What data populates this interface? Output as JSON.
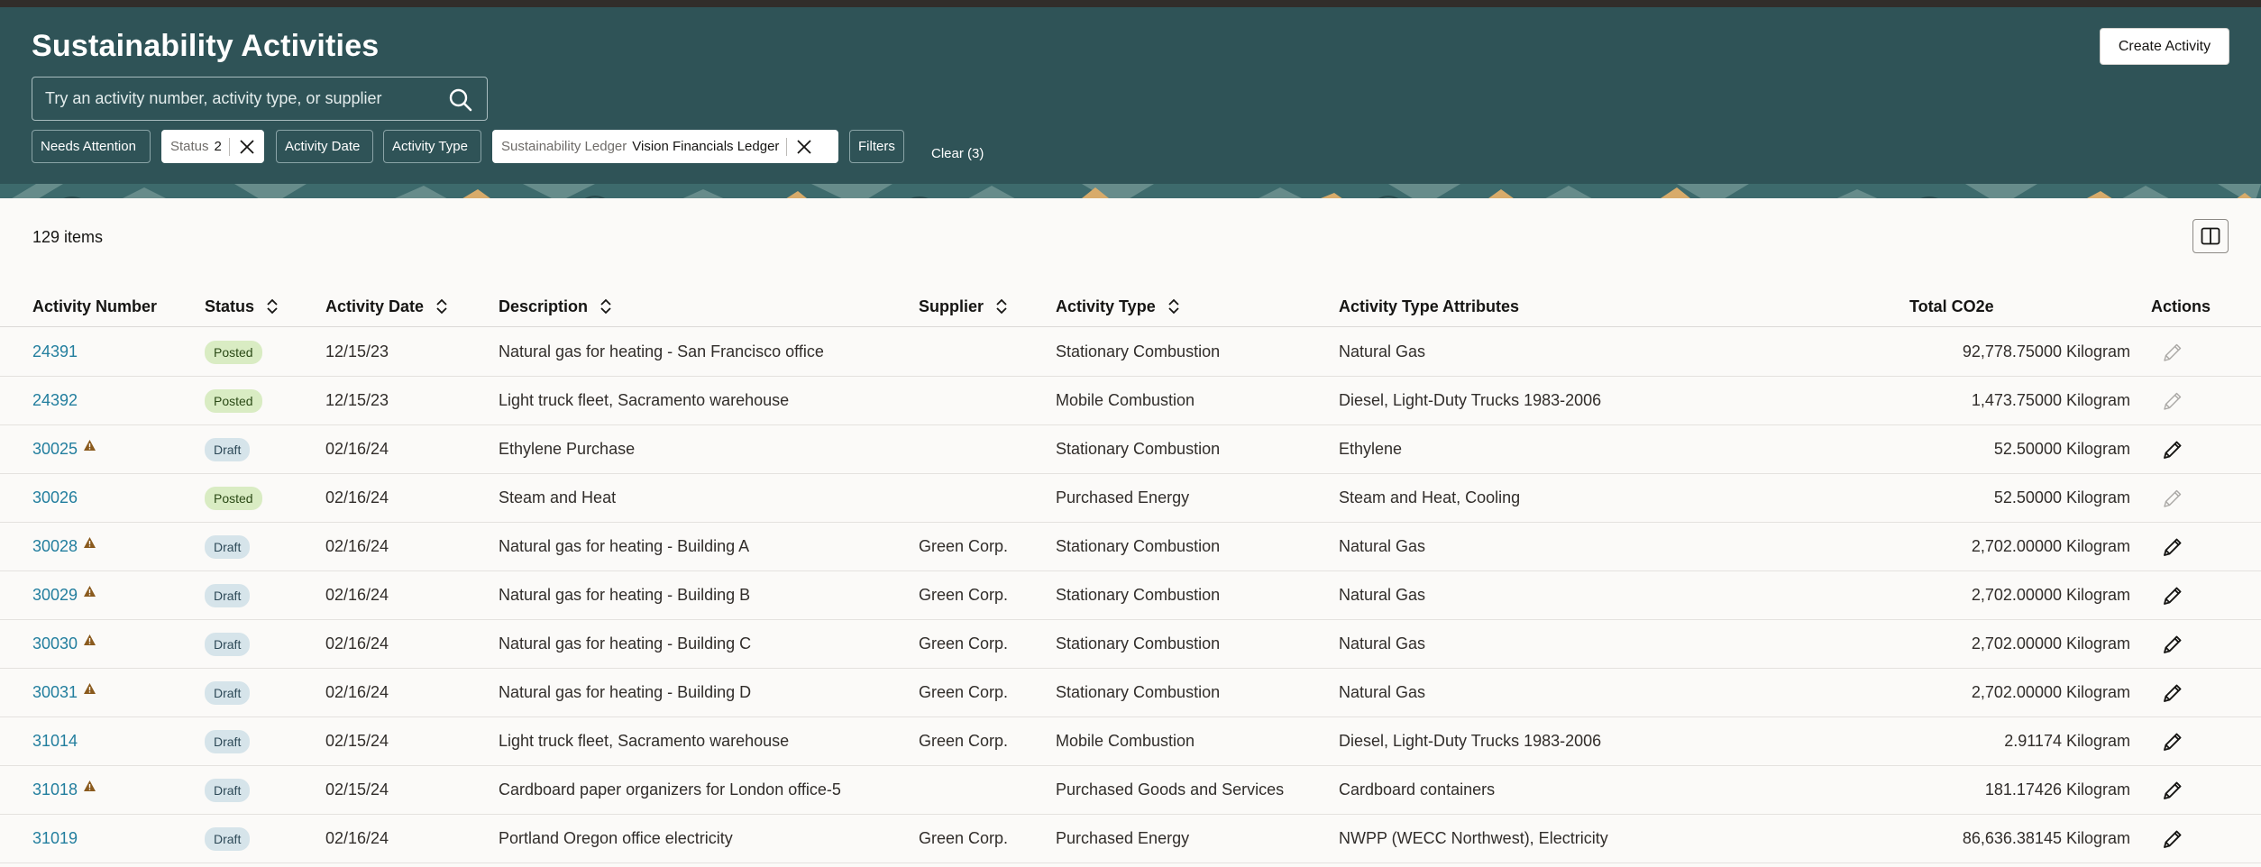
{
  "header": {
    "title": "Sustainability Activities",
    "create_button": "Create Activity",
    "search_placeholder": "Try an activity number, activity type, or supplier",
    "filters": {
      "needs_attention": "Needs Attention",
      "status_label": "Status",
      "status_value": "2",
      "activity_date": "Activity Date",
      "activity_type": "Activity Type",
      "ledger_label": "Sustainability Ledger",
      "ledger_value": "Vision Financials Ledger",
      "filters": "Filters",
      "clear": "Clear (3)"
    }
  },
  "table": {
    "item_count": "129 items",
    "columns": {
      "activity_number": "Activity Number",
      "status": "Status",
      "activity_date": "Activity Date",
      "description": "Description",
      "supplier": "Supplier",
      "activity_type": "Activity Type",
      "attributes": "Activity Type Attributes",
      "total": "Total CO2e",
      "actions": "Actions"
    },
    "rows": [
      {
        "number": "24391",
        "warning": false,
        "status": "Posted",
        "date": "12/15/23",
        "description": "Natural gas for heating - San Francisco office",
        "supplier": "",
        "type": "Stationary Combustion",
        "attributes": "Natural Gas",
        "total": "92,778.75000 Kilogram",
        "editable": false
      },
      {
        "number": "24392",
        "warning": false,
        "status": "Posted",
        "date": "12/15/23",
        "description": "Light truck fleet, Sacramento warehouse",
        "supplier": "",
        "type": "Mobile Combustion",
        "attributes": "Diesel, Light-Duty Trucks 1983-2006",
        "total": "1,473.75000 Kilogram",
        "editable": false
      },
      {
        "number": "30025",
        "warning": true,
        "status": "Draft",
        "date": "02/16/24",
        "description": "Ethylene Purchase",
        "supplier": "",
        "type": "Stationary Combustion",
        "attributes": "Ethylene",
        "total": "52.50000 Kilogram",
        "editable": true
      },
      {
        "number": "30026",
        "warning": false,
        "status": "Posted",
        "date": "02/16/24",
        "description": "Steam and Heat",
        "supplier": "",
        "type": "Purchased Energy",
        "attributes": "Steam and Heat, Cooling",
        "total": "52.50000 Kilogram",
        "editable": false
      },
      {
        "number": "30028",
        "warning": true,
        "status": "Draft",
        "date": "02/16/24",
        "description": "Natural gas for heating - Building A",
        "supplier": "Green Corp.",
        "type": "Stationary Combustion",
        "attributes": "Natural Gas",
        "total": "2,702.00000 Kilogram",
        "editable": true
      },
      {
        "number": "30029",
        "warning": true,
        "status": "Draft",
        "date": "02/16/24",
        "description": "Natural gas for heating - Building B",
        "supplier": "Green Corp.",
        "type": "Stationary Combustion",
        "attributes": "Natural Gas",
        "total": "2,702.00000 Kilogram",
        "editable": true
      },
      {
        "number": "30030",
        "warning": true,
        "status": "Draft",
        "date": "02/16/24",
        "description": "Natural gas for heating - Building C",
        "supplier": "Green Corp.",
        "type": "Stationary Combustion",
        "attributes": "Natural Gas",
        "total": "2,702.00000 Kilogram",
        "editable": true
      },
      {
        "number": "30031",
        "warning": true,
        "status": "Draft",
        "date": "02/16/24",
        "description": "Natural gas for heating - Building D",
        "supplier": "Green Corp.",
        "type": "Stationary Combustion",
        "attributes": "Natural Gas",
        "total": "2,702.00000 Kilogram",
        "editable": true
      },
      {
        "number": "31014",
        "warning": false,
        "status": "Draft",
        "date": "02/15/24",
        "description": "Light truck fleet, Sacramento warehouse",
        "supplier": "Green Corp.",
        "type": "Mobile Combustion",
        "attributes": "Diesel, Light-Duty Trucks 1983-2006",
        "total": "2.91174 Kilogram",
        "editable": true
      },
      {
        "number": "31018",
        "warning": true,
        "status": "Draft",
        "date": "02/15/24",
        "description": "Cardboard paper organizers for London office-5",
        "supplier": "",
        "type": "Purchased Goods and Services",
        "attributes": "Cardboard containers",
        "total": "181.17426 Kilogram",
        "editable": true
      },
      {
        "number": "31019",
        "warning": false,
        "status": "Draft",
        "date": "02/16/24",
        "description": "Portland Oregon office electricity",
        "supplier": "Green Corp.",
        "type": "Purchased Energy",
        "attributes": "NWPP (WECC Northwest), Electricity",
        "total": "86,636.38145 Kilogram",
        "editable": true
      }
    ]
  },
  "icons": {
    "search": "search-icon",
    "close": "close-icon",
    "sort": "sort-icon",
    "warning": "warning-icon",
    "edit": "pencil-icon",
    "columns": "columns-icon"
  },
  "colors": {
    "header_bg": "#2f5357",
    "link": "#227e9e",
    "posted_badge": "#d9ecc3",
    "draft_badge": "#d6e4ea",
    "warning": "#8a5a1d"
  }
}
